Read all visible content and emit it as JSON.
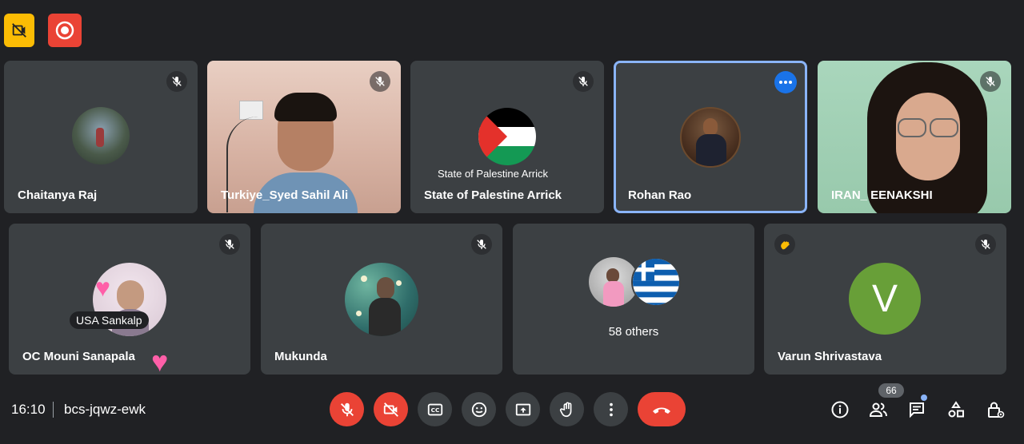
{
  "meeting": {
    "time": "16:10",
    "code": "bcs-jqwz-ewk",
    "participant_count": "66"
  },
  "colors": {
    "background": "#202124",
    "tile": "#3c4043",
    "danger": "#ea4335",
    "accent": "#8ab4f8",
    "record_warning": "#fbbc04"
  },
  "top_bar": {
    "icons": [
      "no-video-icon",
      "recording-icon"
    ]
  },
  "tiles": [
    {
      "name": "Chaitanya Raj",
      "muted": true
    },
    {
      "name": "Turkiye_Syed Sahil Ali",
      "muted": true
    },
    {
      "name": "State of Palestine Arrick",
      "avatar_caption": "State of Palestine Arrick",
      "muted": true
    },
    {
      "name": "Rohan Rao",
      "highlighted": true
    },
    {
      "name": "IRAN_ EENAKSHI",
      "muted": true
    },
    {
      "name": "OC Mouni Sanapala",
      "overlay_name": "USA Sankalp",
      "muted": true
    },
    {
      "name": "Mukunda",
      "muted": true
    },
    {
      "others_label": "58 others"
    },
    {
      "name": "Varun Shrivastava",
      "avatar_letter": "V",
      "hand_raised": true,
      "muted": true
    }
  ],
  "controls": [
    "mic-off-icon",
    "camera-off-icon",
    "captions-icon",
    "emoji-icon",
    "present-icon",
    "raise-hand-icon",
    "more-options-icon",
    "leave-call-icon"
  ],
  "right_controls": [
    "info-icon",
    "people-icon",
    "chat-icon",
    "activities-icon",
    "host-controls-icon"
  ]
}
